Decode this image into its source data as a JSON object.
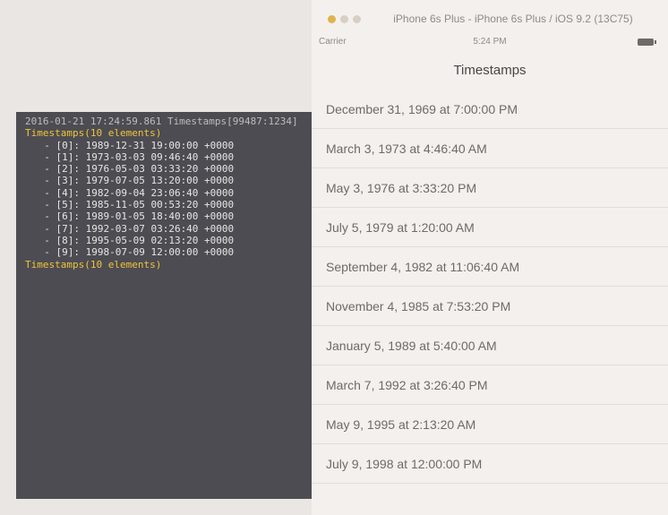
{
  "console": {
    "lines": [
      {
        "text": "2016-01-21 17:24:59.861 Timestamps[99487:1234]",
        "cls": "gray"
      },
      {
        "text": "Timestamps(10 elements)",
        "cls": "hl"
      },
      {
        "text": "  - [0]: 1989-12-31 19:00:00 +0000",
        "cls": "indent"
      },
      {
        "text": "  - [1]: 1973-03-03 09:46:40 +0000",
        "cls": "indent"
      },
      {
        "text": "  - [2]: 1976-05-03 03:33:20 +0000",
        "cls": "indent"
      },
      {
        "text": "  - [3]: 1979-07-05 13:20:00 +0000",
        "cls": "indent"
      },
      {
        "text": "  - [4]: 1982-09-04 23:06:40 +0000",
        "cls": "indent"
      },
      {
        "text": "  - [5]: 1985-11-05 00:53:20 +0000",
        "cls": "indent"
      },
      {
        "text": "  - [6]: 1989-01-05 18:40:00 +0000",
        "cls": "indent"
      },
      {
        "text": "  - [7]: 1992-03-07 03:26:40 +0000",
        "cls": "indent"
      },
      {
        "text": "  - [8]: 1995-05-09 02:13:20 +0000",
        "cls": "indent"
      },
      {
        "text": "  - [9]: 1998-07-09 12:00:00 +0000",
        "cls": "indent"
      },
      {
        "text": "Timestamps(10 elements)",
        "cls": "hl"
      }
    ]
  },
  "simulator": {
    "window_title": "iPhone 6s Plus - iPhone 6s Plus / iOS 9.2 (13C75)",
    "status": {
      "carrier": "Carrier",
      "time": "5:24 PM"
    },
    "nav_title": "Timestamps",
    "rows": [
      "December 31, 1969 at 7:00:00 PM",
      "March 3, 1973 at 4:46:40 AM",
      "May 3, 1976 at 3:33:20 PM",
      "July 5, 1979 at 1:20:00 AM",
      "September 4, 1982 at 11:06:40 AM",
      "November 4, 1985 at 7:53:20 PM",
      "January 5, 1989 at 5:40:00 AM",
      "March 7, 1992 at 3:26:40 PM",
      "May 9, 1995 at 2:13:20 AM",
      "July 9, 1998 at 12:00:00 PM"
    ]
  }
}
